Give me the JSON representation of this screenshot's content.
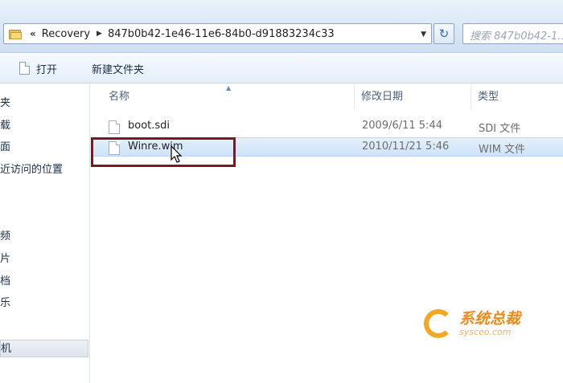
{
  "address": {
    "crumb_overflow": "«",
    "crumbs": [
      "Recovery",
      "847b0b42-1e46-11e6-84b0-d91883234c33"
    ],
    "search_placeholder": "搜索 847b0b42-1..."
  },
  "toolbar": {
    "open_label": "打开",
    "new_folder_label": "新建文件夹"
  },
  "sidebar": {
    "items": [
      {
        "label": "夹"
      },
      {
        "label": "载"
      },
      {
        "label": "面"
      },
      {
        "label": "近访问的位置"
      },
      {
        "label": "频"
      },
      {
        "label": "片"
      },
      {
        "label": "档"
      },
      {
        "label": "乐"
      },
      {
        "label": "机",
        "selected": true
      }
    ]
  },
  "columns": {
    "name": "名称",
    "modified": "修改日期",
    "type": "类型"
  },
  "files": [
    {
      "name": "boot.sdi",
      "modified": "2009/6/11 5:44",
      "type": "SDI 文件",
      "selected": false
    },
    {
      "name": "Winre.wim",
      "modified": "2010/11/21 5:46",
      "type": "WIM 文件",
      "selected": true
    }
  ],
  "watermark": {
    "title": "系统总裁",
    "subtitle": "sysceo.com"
  },
  "colors": {
    "highlight_box": "#7b1a1e",
    "selection": "#cde3f9"
  }
}
